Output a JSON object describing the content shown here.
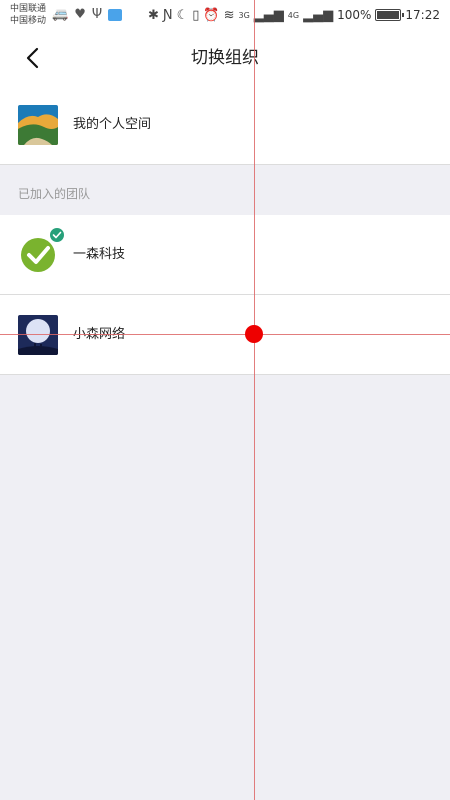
{
  "status_bar": {
    "carrier_1": "中国联通",
    "carrier_2": "中国移动",
    "battery": "100%",
    "time": "17:22",
    "net_1": "3G",
    "net_2": "4G"
  },
  "nav": {
    "title": "切换组织"
  },
  "personal": {
    "label": "我的个人空间"
  },
  "teams_section": {
    "header": "已加入的团队",
    "items": [
      {
        "label": "一森科技",
        "selected": true
      },
      {
        "label": "小森网络",
        "selected": false
      }
    ]
  },
  "colors": {
    "accent_check": "#27a07a",
    "page_bg": "#efeff4",
    "marker": "#ee0000"
  }
}
